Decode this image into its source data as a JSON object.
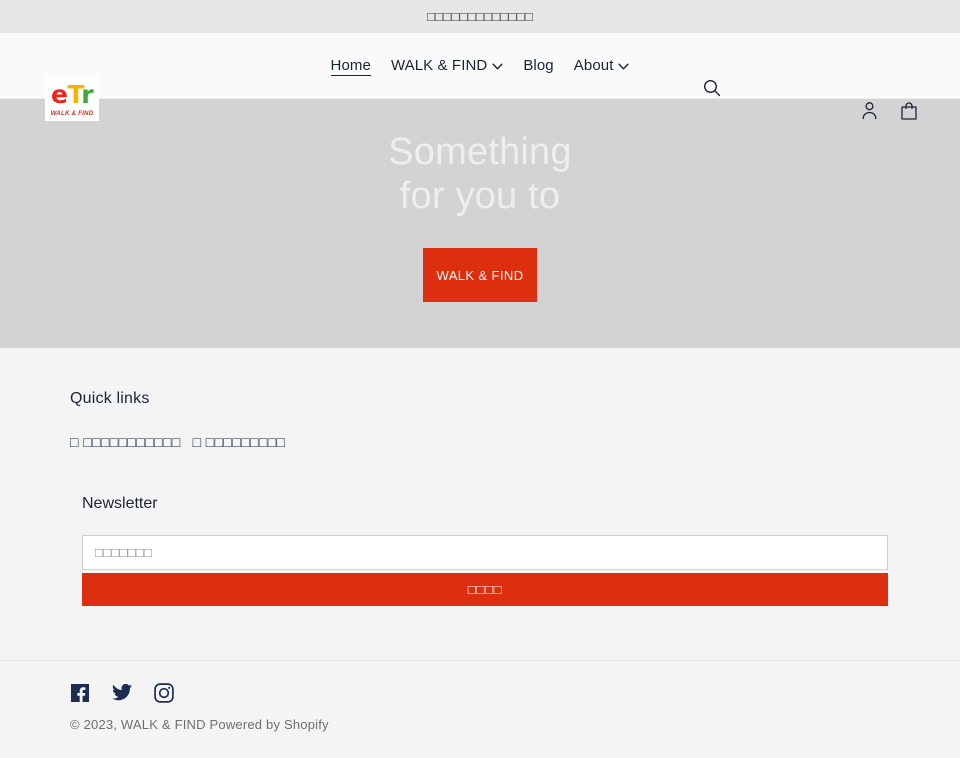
{
  "announcement": {
    "text": "□□□□□□□□□□□□□"
  },
  "header": {
    "logo": {
      "letter_e": "e",
      "letter_t": "T",
      "letter_r": "r",
      "tagline": "WALK & FIND"
    },
    "nav": [
      {
        "label": "Home",
        "has_chevron": false,
        "active": true
      },
      {
        "label": "WALK & FIND",
        "has_chevron": true,
        "active": false
      },
      {
        "label": "Blog",
        "has_chevron": false,
        "active": false
      },
      {
        "label": "About",
        "has_chevron": true,
        "active": false
      }
    ],
    "icons": {
      "search": "search-icon",
      "account": "account-icon",
      "cart": "cart-icon"
    }
  },
  "hero": {
    "title_line1": "Something",
    "title_line2": "for you to",
    "cta_label": "WALK & FIND"
  },
  "footer": {
    "quick_links_heading": "Quick links",
    "quick_links": [
      {
        "label": "□ □□□□□□□□□□□"
      },
      {
        "label": "□ □□□□□□□□□"
      }
    ],
    "newsletter_heading": "Newsletter",
    "newsletter_placeholder": "□□□□□□□",
    "newsletter_value": "",
    "newsletter_submit_label": "□□□□",
    "social": [
      {
        "name": "facebook-icon",
        "label": "Facebook"
      },
      {
        "name": "twitter-icon",
        "label": "Twitter"
      },
      {
        "name": "instagram-icon",
        "label": "Instagram"
      }
    ],
    "copyright": "© 2023, WALK & FIND",
    "powered_by": "Powered by Shopify"
  },
  "colors": {
    "accent": "#dd2f10",
    "announcement_bg": "#e7e7e7",
    "hero_bg": "#d3d3d3",
    "footer_bg": "#f4f4f4",
    "text": "#1c2434",
    "social": "#1c2d4f"
  }
}
